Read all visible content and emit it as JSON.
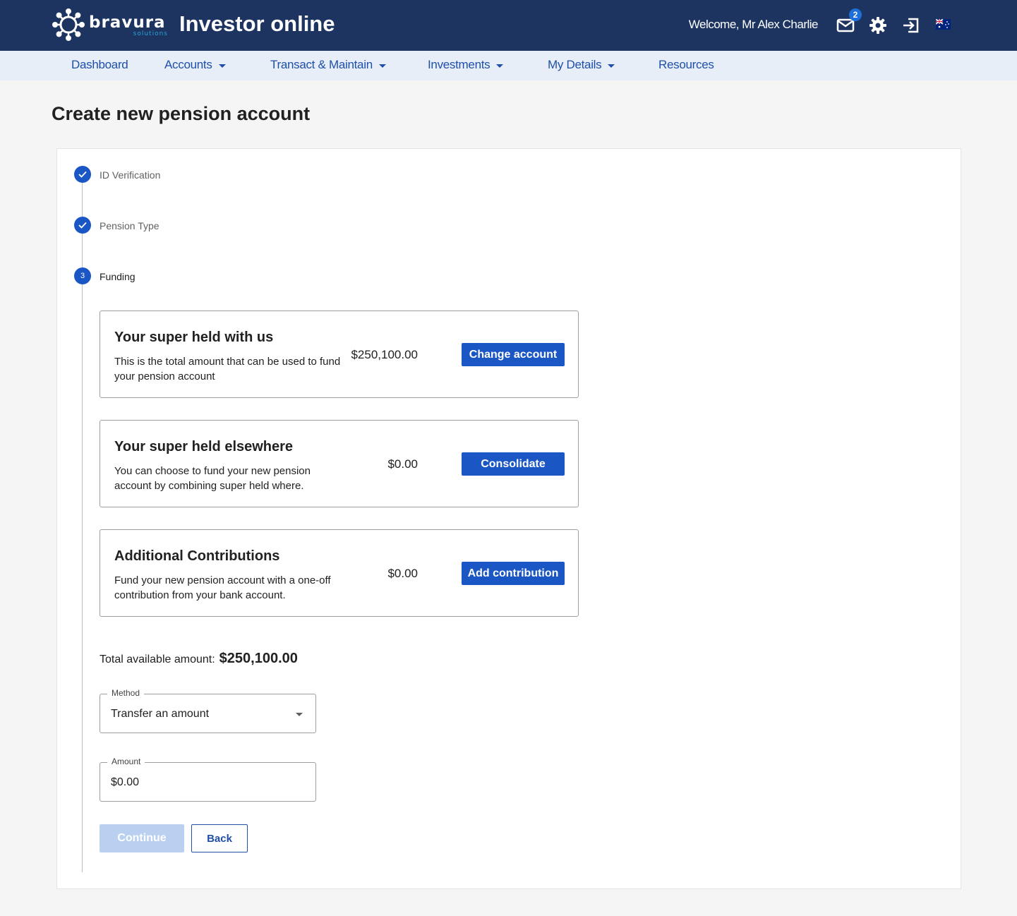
{
  "header": {
    "brand_name": "bravura",
    "brand_sub": "solutions",
    "app_title": "Investor online",
    "welcome": "Welcome, Mr Alex Charlie",
    "mail_badge": "2",
    "icons": [
      "mail-icon",
      "gear-icon",
      "logout-icon",
      "australia-flag-icon"
    ]
  },
  "nav": {
    "items": [
      {
        "label": "Dashboard",
        "has_dropdown": false
      },
      {
        "label": "Accounts",
        "has_dropdown": true
      },
      {
        "label": "Transact & Maintain",
        "has_dropdown": true
      },
      {
        "label": "Investments",
        "has_dropdown": true
      },
      {
        "label": "My Details",
        "has_dropdown": true
      },
      {
        "label": "Resources",
        "has_dropdown": false
      }
    ]
  },
  "page": {
    "title": "Create new pension account"
  },
  "steps": [
    {
      "label": "ID Verification",
      "status": "complete"
    },
    {
      "label": "Pension Type",
      "status": "complete"
    },
    {
      "label": "Funding",
      "status": "active",
      "number": "3"
    }
  ],
  "funding": {
    "boxes": [
      {
        "title": "Your super held with us",
        "description": "This is the total amount that can be used to fund your pension account",
        "amount": "$250,100.00",
        "button": "Change account"
      },
      {
        "title": "Your super held elsewhere",
        "description": "You can choose to fund your new pension account by combining super held where.",
        "amount": "$0.00",
        "button": "Consolidate"
      },
      {
        "title": "Additional Contributions",
        "description": "Fund your new pension account with a one-off contribution from your bank account.",
        "amount": "$0.00",
        "button": "Add contribution"
      }
    ],
    "total_label": "Total available amount:",
    "total_value": "$250,100.00",
    "method": {
      "label": "Method",
      "value": "Transfer an amount"
    },
    "amount": {
      "label": "Amount",
      "value": "$0.00"
    },
    "continue_label": "Continue",
    "back_label": "Back"
  },
  "colors": {
    "header_bg": "#1d3461",
    "nav_bg": "#e7eef8",
    "primary": "#1a56c4",
    "nav_text": "#1f4fa8",
    "disabled_button": "#b9d0f0"
  }
}
